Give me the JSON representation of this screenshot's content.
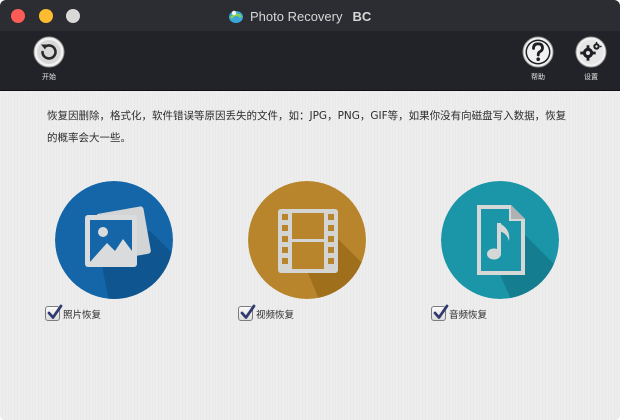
{
  "window": {
    "title": "Photo Recovery",
    "title_suffix": "BC"
  },
  "toolbar": {
    "start_label": "开始",
    "help_label": "帮助",
    "settings_label": "设置"
  },
  "main": {
    "description": "恢复因删除，格式化，软件错误等原因丢失的文件，如：JPG，PNG，GIF等，如果你没有向磁盘写入数据，恢复的概率会大一些。",
    "options": [
      {
        "label": "照片恢复",
        "checked": true,
        "color": "#1466a8",
        "icon": "image-icon"
      },
      {
        "label": "视频恢复",
        "checked": true,
        "color": "#b8842c",
        "icon": "film-icon"
      },
      {
        "label": "音频恢复",
        "checked": true,
        "color": "#1b95a8",
        "icon": "music-file-icon"
      }
    ]
  },
  "colors": {
    "titlebar": "#2b2d32",
    "toolbar": "#222328",
    "close": "#fc5b57",
    "minimize": "#fdbd2f",
    "zoom": "#d9d9d9"
  }
}
